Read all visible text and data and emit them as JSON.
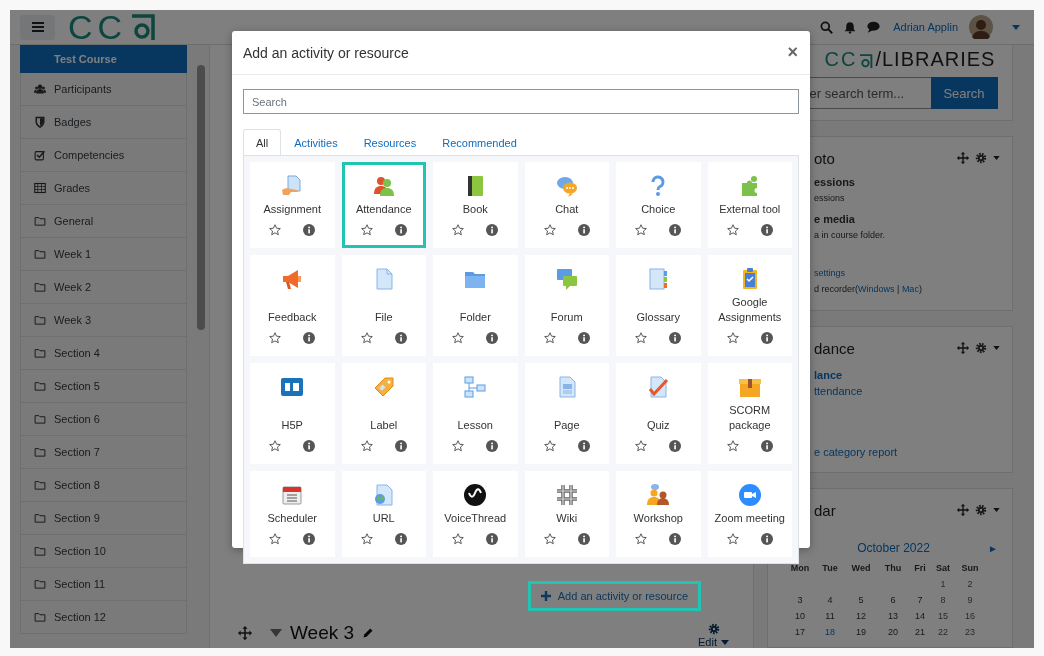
{
  "top_bar": {
    "logo_text": "CC",
    "user_name": "Adrian Applin"
  },
  "sidebar": {
    "items": [
      {
        "label": "Test Course",
        "kind": "course",
        "selected": true
      },
      {
        "label": "Participants",
        "kind": "users",
        "selected": false
      },
      {
        "label": "Badges",
        "kind": "shield",
        "selected": false
      },
      {
        "label": "Competencies",
        "kind": "check",
        "selected": false
      },
      {
        "label": "Grades",
        "kind": "table",
        "selected": false
      },
      {
        "label": "General",
        "kind": "section",
        "selected": false
      },
      {
        "label": "Week 1",
        "kind": "section",
        "selected": false
      },
      {
        "label": "Week 2",
        "kind": "section",
        "selected": false
      },
      {
        "label": "Week 3",
        "kind": "section",
        "selected": false
      },
      {
        "label": "Section 4",
        "kind": "section",
        "selected": false
      },
      {
        "label": "Section 5",
        "kind": "section",
        "selected": false
      },
      {
        "label": "Section 6",
        "kind": "section",
        "selected": false
      },
      {
        "label": "Section 7",
        "kind": "section",
        "selected": false
      },
      {
        "label": "Section 8",
        "kind": "section",
        "selected": false
      },
      {
        "label": "Section 9",
        "kind": "section",
        "selected": false
      },
      {
        "label": "Section 10",
        "kind": "section",
        "selected": false
      },
      {
        "label": "Section 11",
        "kind": "section",
        "selected": false
      },
      {
        "label": "Section 12",
        "kind": "section",
        "selected": false
      }
    ]
  },
  "main": {
    "add_button": {
      "label": "Add an activity or resource",
      "highlighted": true
    },
    "section": {
      "title": "Week 3",
      "edit_label": "Edit"
    }
  },
  "right_column": {
    "libraries": {
      "logo_text": "CC",
      "logo_suffix": "/LIBRARIES",
      "search_placeholder": "er search term...",
      "search_button": "Search"
    },
    "blocks": [
      {
        "title": "oto",
        "lines": [
          {
            "kind": "heading",
            "text": "essions"
          },
          {
            "kind": "note",
            "text": "essions"
          },
          {
            "kind": "heading",
            "text": "e media"
          },
          {
            "kind": "note",
            "text": "a in course folder."
          },
          {
            "kind": "separated_link",
            "text": "settings"
          },
          {
            "kind": "link_line",
            "prefix": "d recorder(",
            "first_link": "Windows",
            "separator": " | ",
            "second_link": "Mac",
            "suffix": ")"
          }
        ]
      },
      {
        "title": "dance",
        "lines": [
          {
            "kind": "heading_link",
            "text": "lance"
          },
          {
            "kind": "link",
            "text": "ttendance"
          },
          {
            "kind": "footer_link",
            "text": "e category report"
          }
        ]
      }
    ],
    "calendar": {
      "title": "dar",
      "month": "October 2022",
      "next": "►",
      "weekdays": [
        "Mon",
        "Tue",
        "Wed",
        "Thu",
        "Fri",
        "Sat",
        "Sun"
      ],
      "weeks": [
        [
          {
            "label": "1",
            "today": false
          },
          {
            "label": "2",
            "today": false
          }
        ],
        [
          {
            "label": "3",
            "today": false
          },
          {
            "label": "4",
            "today": false
          },
          {
            "label": "5",
            "today": false
          },
          {
            "label": "6",
            "today": false
          },
          {
            "label": "7",
            "today": false
          },
          {
            "label": "8",
            "today": false
          },
          {
            "label": "9",
            "today": false
          }
        ],
        [
          {
            "label": "10",
            "today": false
          },
          {
            "label": "11",
            "today": false
          },
          {
            "label": "12",
            "today": false
          },
          {
            "label": "13",
            "today": false
          },
          {
            "label": "14",
            "today": false
          },
          {
            "label": "15",
            "today": false
          },
          {
            "label": "16",
            "today": false
          }
        ],
        [
          {
            "label": "17",
            "today": false
          },
          {
            "label": "18",
            "today": true
          },
          {
            "label": "19",
            "today": false
          },
          {
            "label": "20",
            "today": false
          },
          {
            "label": "21",
            "today": false
          },
          {
            "label": "22",
            "today": false
          },
          {
            "label": "23",
            "today": false
          }
        ]
      ]
    }
  },
  "modal": {
    "title": "Add an activity or resource",
    "close": "×",
    "search_placeholder": "Search",
    "tabs": [
      {
        "label": "All",
        "selected": true
      },
      {
        "label": "Activities",
        "selected": false
      },
      {
        "label": "Resources",
        "selected": false
      },
      {
        "label": "Recommended",
        "selected": false
      }
    ],
    "items": [
      {
        "name": "Assignment",
        "starred": false,
        "highlighted": false
      },
      {
        "name": "Attendance",
        "starred": false,
        "highlighted": true
      },
      {
        "name": "Book",
        "starred": false,
        "highlighted": false
      },
      {
        "name": "Chat",
        "starred": false,
        "highlighted": false
      },
      {
        "name": "Choice",
        "starred": false,
        "highlighted": false
      },
      {
        "name": "External tool",
        "starred": false,
        "highlighted": false
      },
      {
        "name": "Feedback",
        "starred": false,
        "highlighted": false
      },
      {
        "name": "File",
        "starred": false,
        "highlighted": false
      },
      {
        "name": "Folder",
        "starred": false,
        "highlighted": false
      },
      {
        "name": "Forum",
        "starred": false,
        "highlighted": false
      },
      {
        "name": "Glossary",
        "starred": false,
        "highlighted": false
      },
      {
        "name": "Google Assignments",
        "starred": false,
        "highlighted": false
      },
      {
        "name": "H5P",
        "starred": false,
        "highlighted": false
      },
      {
        "name": "Label",
        "starred": false,
        "highlighted": false
      },
      {
        "name": "Lesson",
        "starred": false,
        "highlighted": false
      },
      {
        "name": "Page",
        "starred": false,
        "highlighted": false
      },
      {
        "name": "Quiz",
        "starred": false,
        "highlighted": false
      },
      {
        "name": "SCORM package",
        "starred": false,
        "highlighted": false
      },
      {
        "name": "Scheduler",
        "starred": false,
        "highlighted": false
      },
      {
        "name": "URL",
        "starred": false,
        "highlighted": false
      },
      {
        "name": "VoiceThread",
        "starred": false,
        "highlighted": false
      },
      {
        "name": "Wiki",
        "starred": false,
        "highlighted": false
      },
      {
        "name": "Workshop",
        "starred": false,
        "highlighted": false
      },
      {
        "name": "Zoom meeting",
        "starred": false,
        "highlighted": false
      }
    ]
  }
}
